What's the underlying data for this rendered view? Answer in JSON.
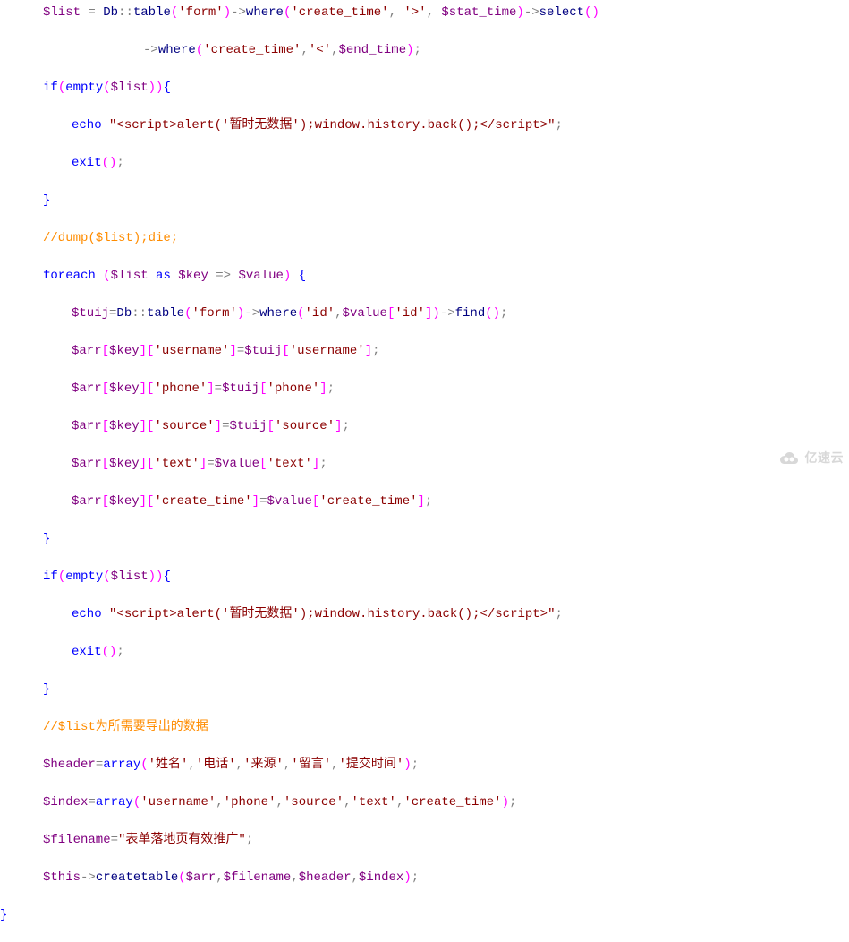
{
  "code": {
    "l1": {
      "v1": "$list",
      "op1": " = ",
      "fn1": "Db",
      "op2": "::",
      "fn2": "table",
      "p1": "(",
      "s1": "'form'",
      "p2": ")",
      "op3": "->",
      "fn3": "where",
      "p3": "(",
      "s2": "'create_time'",
      "c1": ",",
      "s3": " '>'",
      "c2": ",",
      "v2": " $stat_time",
      "p4": ")",
      "op4": "->",
      "fn4": "select",
      "p5": "()"
    },
    "l2": {
      "op1": "->",
      "fn1": "where",
      "p1": "(",
      "s1": "'create_time'",
      "c1": ",",
      "s2": "'<'",
      "c2": ",",
      "v1": "$end_time",
      "p2": ")",
      "sc": ";"
    },
    "l3": {
      "kw": "if",
      "p1": "(",
      "kw2": "empty",
      "p2": "(",
      "v1": "$list",
      "p3": "))",
      "br": "{"
    },
    "l4": {
      "kw": "echo ",
      "s1": "\"<script>alert('暂时无数据');window.history.back();</script>\"",
      "sc": ";"
    },
    "l5": {
      "kw": "exit",
      "p1": "()",
      "sc": ";"
    },
    "l6": {
      "br": "}"
    },
    "l7": {
      "cmt": "//dump($list);die;"
    },
    "l8": {
      "kw": "foreach ",
      "p1": "(",
      "v1": "$list",
      "kw2": " as ",
      "v2": "$key",
      "op": " => ",
      "v3": "$value",
      "p2": ") ",
      "br": "{"
    },
    "l9": {
      "v1": "$tuij",
      "op1": "=",
      "fn1": "Db",
      "op2": "::",
      "fn2": "table",
      "p1": "(",
      "s1": "'form'",
      "p2": ")",
      "op3": "->",
      "fn3": "where",
      "p3": "(",
      "s2": "'id'",
      "c1": ",",
      "v2": "$value",
      "b1": "[",
      "s3": "'id'",
      "b2": "]",
      "p4": ")",
      "op4": "->",
      "fn4": "find",
      "p5": "()",
      "sc": ";"
    },
    "l10": {
      "v1": "$arr",
      "b1": "[",
      "v2": "$key",
      "b2": "][",
      "s1": "'username'",
      "b3": "]",
      "op": "=",
      "v3": "$tuij",
      "b4": "[",
      "s2": "'username'",
      "b5": "]",
      "sc": ";"
    },
    "l11": {
      "v1": "$arr",
      "b1": "[",
      "v2": "$key",
      "b2": "][",
      "s1": "'phone'",
      "b3": "]",
      "op": "=",
      "v3": "$tuij",
      "b4": "[",
      "s2": "'phone'",
      "b5": "]",
      "sc": ";"
    },
    "l12": {
      "v1": "$arr",
      "b1": "[",
      "v2": "$key",
      "b2": "][",
      "s1": "'source'",
      "b3": "]",
      "op": "=",
      "v3": "$tuij",
      "b4": "[",
      "s2": "'source'",
      "b5": "]",
      "sc": ";"
    },
    "l13": {
      "v1": "$arr",
      "b1": "[",
      "v2": "$key",
      "b2": "][",
      "s1": "'text'",
      "b3": "]",
      "op": "=",
      "v3": "$value",
      "b4": "[",
      "s2": "'text'",
      "b5": "]",
      "sc": ";"
    },
    "l14": {
      "v1": "$arr",
      "b1": "[",
      "v2": "$key",
      "b2": "][",
      "s1": "'create_time'",
      "b3": "]",
      "op": "=",
      "v3": "$value",
      "b4": "[",
      "s2": "'create_time'",
      "b5": "]",
      "sc": ";"
    },
    "l15": {
      "br": "}"
    },
    "l16": {
      "kw": "if",
      "p1": "(",
      "kw2": "empty",
      "p2": "(",
      "v1": "$list",
      "p3": "))",
      "br": "{"
    },
    "l17": {
      "kw": "echo ",
      "s1": "\"<script>alert('暂时无数据');window.history.back();</script>\"",
      "sc": ";"
    },
    "l18": {
      "kw": "exit",
      "p1": "()",
      "sc": ";"
    },
    "l19": {
      "br": "}"
    },
    "l20": {
      "cmt": "//$list为所需要导出的数据"
    },
    "l21": {
      "v1": "$header",
      "op": "=",
      "kw": "array",
      "p1": "(",
      "s1": "'姓名'",
      "c1": ",",
      "s2": "'电话'",
      "c2": ",",
      "s3": "'来源'",
      "c3": ",",
      "s4": "'留言'",
      "c4": ",",
      "s5": "'提交时间'",
      "p2": ")",
      "sc": ";"
    },
    "l22": {
      "v1": "$index",
      "op": "=",
      "kw": "array",
      "p1": "(",
      "s1": "'username'",
      "c1": ",",
      "s2": "'phone'",
      "c2": ",",
      "s3": "'source'",
      "c3": ",",
      "s4": "'text'",
      "c4": ",",
      "s5": "'create_time'",
      "p2": ")",
      "sc": ";"
    },
    "l23": {
      "v1": "$filename",
      "op": "=",
      "s1": "\"表单落地页有效推广\"",
      "sc": ";"
    },
    "l24": {
      "v1": "$this",
      "op": "->",
      "fn": "createtable",
      "p1": "(",
      "v2": "$arr",
      "c1": ",",
      "v3": "$filename",
      "c2": ",",
      "v4": "$header",
      "c3": ",",
      "v5": "$index",
      "p2": ")",
      "sc": ";"
    },
    "l25": {
      "br": "}"
    }
  },
  "watermark": "亿速云"
}
